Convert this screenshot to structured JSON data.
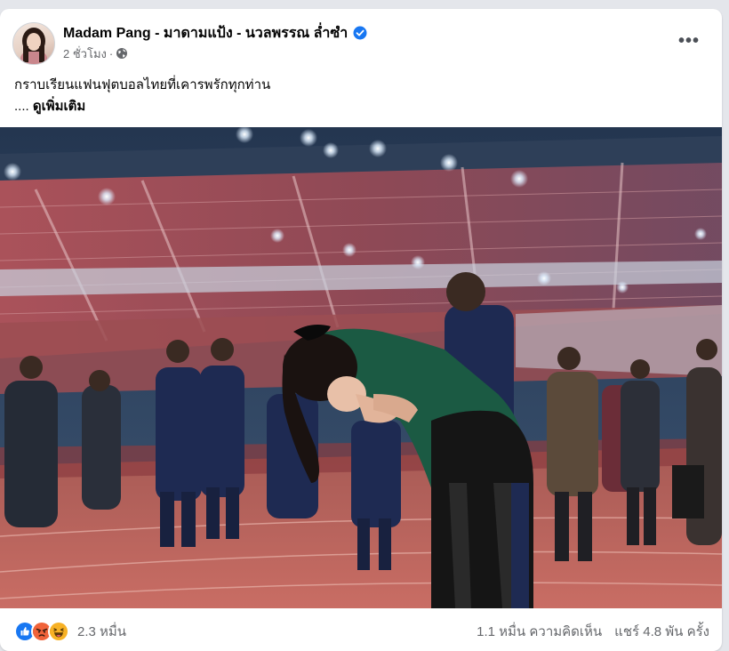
{
  "post": {
    "author": "Madam Pang - มาดามแป้ง - นวลพรรณ ล่ำซำ",
    "time": "2 ชั่วโมง",
    "separator": "·",
    "caption": "กราบเรียนแฟนฟุตบอลไทยที่เคารพรักทุกท่าน",
    "see_more_prefix": "....",
    "see_more_label": "ดูเพิ่มเติม",
    "more_label": "•••"
  },
  "footer": {
    "reaction_count": "2.3 หมื่น",
    "comments": "1.1 หมื่น ความคิดเห็น",
    "shares": "แชร์ 4.8 พัน ครั้ง",
    "reaction_icons": [
      "like-icon",
      "angry-icon",
      "haha-icon"
    ]
  },
  "colors": {
    "brand_blue": "#1877f2",
    "angry": "#f0633a",
    "haha": "#f7b125",
    "text_secondary": "#65676b"
  }
}
